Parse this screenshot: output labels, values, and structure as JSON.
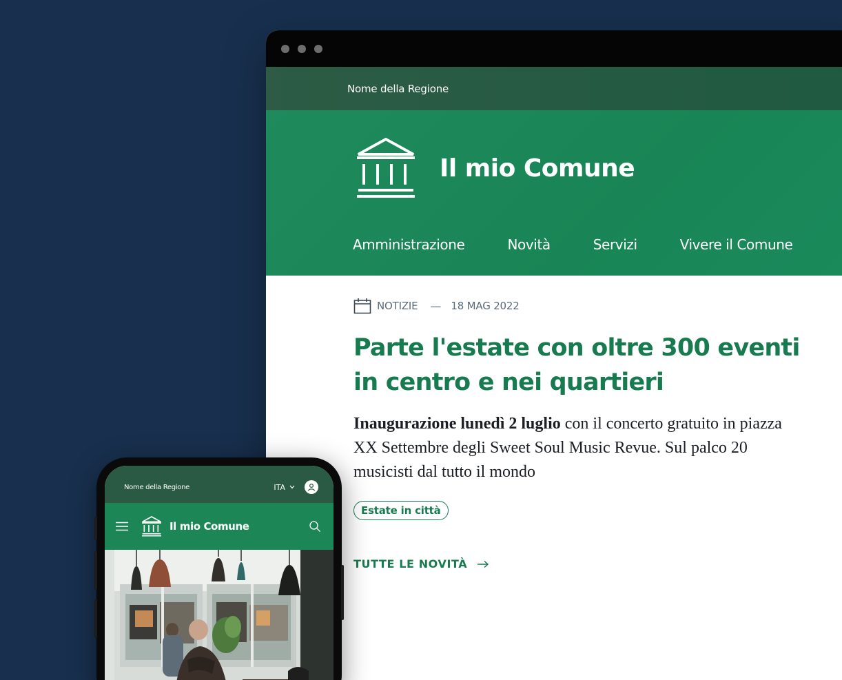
{
  "desktop": {
    "region_name": "Nome della Regione",
    "site_title": "Il mio Comune",
    "nav": [
      {
        "label": "Amministrazione"
      },
      {
        "label": "Novità"
      },
      {
        "label": "Servizi"
      },
      {
        "label": "Vivere il Comune"
      }
    ],
    "article": {
      "category": "NOTIZIE",
      "separator": "—",
      "date": "18 MAG 2022",
      "headline": "Parte l'estate con oltre 300 eventi in centro e nei quartieri",
      "lead_bold": "Inaugurazione lunedì 2 luglio",
      "lead_rest": " con il concerto gratuito in piazza XX Settembre degli Sweet Soul Music Revue. Sul palco 20 musicisti dal tutto il mondo",
      "tag": "Estate in città",
      "all_news": "TUTTE LE NOVITÀ"
    }
  },
  "mobile": {
    "region_name": "Nome della Regione",
    "language": "ITA",
    "site_title": "Il mio Comune"
  },
  "colors": {
    "background": "#18304e",
    "primary_green": "#1d8656",
    "dark_green": "#2a5a43",
    "headline_green": "#187a4f"
  },
  "icons": [
    "browser-dot",
    "municipality-icon",
    "calendar-icon",
    "arrow-right-icon",
    "hamburger-icon",
    "search-icon",
    "user-icon",
    "chevron-down-icon"
  ]
}
